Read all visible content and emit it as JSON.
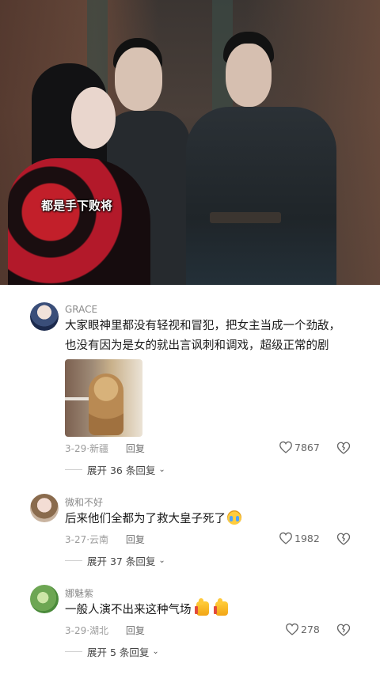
{
  "video": {
    "subtitle": "都是手下败将"
  },
  "comments": [
    {
      "username": "GRACE",
      "text_lines": [
        "大家眼神里都没有轻视和冒犯，把女主当成一个劲敌，",
        "也没有因为是女的就出言讽刺和调戏，超级正常的剧"
      ],
      "has_image": true,
      "date_location": "3-29·新疆",
      "reply_label": "回复",
      "likes": "7867",
      "expand_label": "展开 36 条回复"
    },
    {
      "username": "微和不好",
      "text": "后来他们全都为了救大皇子死了",
      "emoji": "crying-face",
      "date_location": "3-27·云南",
      "reply_label": "回复",
      "likes": "1982",
      "expand_label": "展开 37 条回复"
    },
    {
      "username": "娜魅紫",
      "text": "一般人演不出来这种气场",
      "emoji": "thumbs-up x2",
      "date_location": "3-29·湖北",
      "reply_label": "回复",
      "likes": "278",
      "expand_label": "展开 5 条回复"
    }
  ],
  "colors": {
    "text_primary": "#1a1a1a",
    "text_secondary": "#8a8a8a",
    "background": "#ffffff"
  }
}
